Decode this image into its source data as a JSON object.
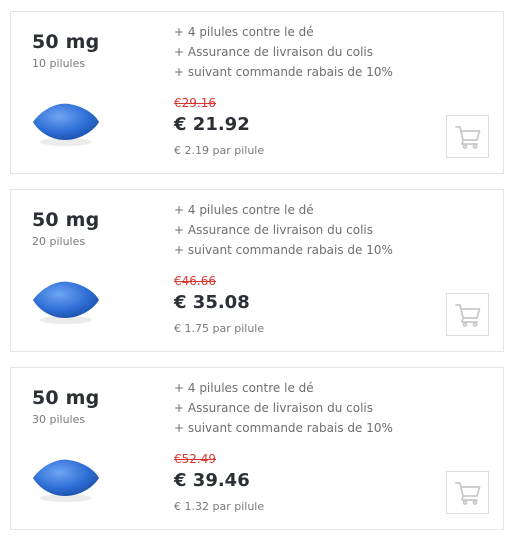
{
  "colors": {
    "old_price": "#d9362f",
    "text_dark": "#2b2f36",
    "text_muted": "#7a7a7a",
    "pill_blue": "#2f6fd6",
    "cart_icon": "#c9c9c9"
  },
  "offers": [
    {
      "dose": "50 mg",
      "count": "10 pilules",
      "features": [
        "+ 4 pilules contre le dé",
        "+ Assurance de livraison du colis",
        "+ suivant commande rabais de 10%"
      ],
      "old_price": "€29.16",
      "price": "€ 21.92",
      "per_pill": "€ 2.19 par pilule",
      "pill_icon": "blue-diamond-pill-icon",
      "cart_icon": "shopping-cart-icon"
    },
    {
      "dose": "50 mg",
      "count": "20 pilules",
      "features": [
        "+ 4 pilules contre le dé",
        "+ Assurance de livraison du colis",
        "+ suivant commande rabais de 10%"
      ],
      "old_price": "€46.66",
      "price": "€ 35.08",
      "per_pill": "€ 1.75 par pilule",
      "pill_icon": "blue-diamond-pill-icon",
      "cart_icon": "shopping-cart-icon"
    },
    {
      "dose": "50 mg",
      "count": "30 pilules",
      "features": [
        "+ 4 pilules contre le dé",
        "+ Assurance de livraison du colis",
        "+ suivant commande rabais de 10%"
      ],
      "old_price": "€52.49",
      "price": "€ 39.46",
      "per_pill": "€ 1.32 par pilule",
      "pill_icon": "blue-diamond-pill-icon",
      "cart_icon": "shopping-cart-icon"
    }
  ]
}
